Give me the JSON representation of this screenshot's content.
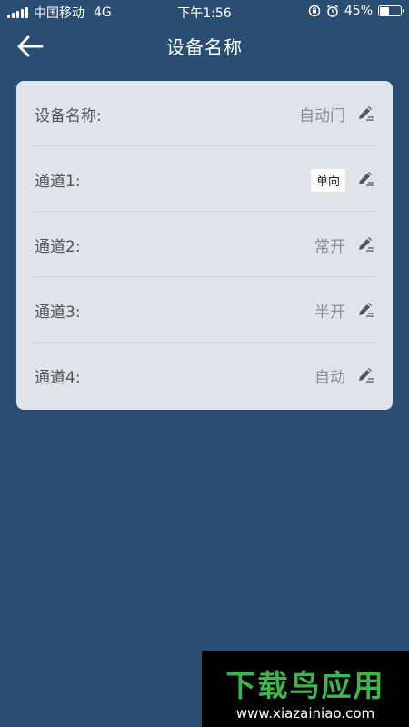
{
  "status_bar": {
    "carrier": "中国移动",
    "network": "4G",
    "time": "下午1:56",
    "battery_percent": "45%",
    "battery_level": 0.45,
    "icons": [
      "signal-icon",
      "lock-rotation-icon",
      "alarm-icon",
      "battery-icon"
    ]
  },
  "header": {
    "title": "设备名称",
    "back_icon": "arrow-left-icon"
  },
  "rows": [
    {
      "label": "设备名称:",
      "value": "自动门"
    },
    {
      "label": "通道1:",
      "value": "单向"
    },
    {
      "label": "通道2:",
      "value": "常开"
    },
    {
      "label": "通道3:",
      "value": "半开"
    },
    {
      "label": "通道4:",
      "value": "自动"
    }
  ],
  "watermark": {
    "brand": "下载鸟应用",
    "url": "www.xiazainiao.com"
  },
  "colors": {
    "background": "#2a4d72",
    "card": "#dfe3ea",
    "label_text": "#555555",
    "value_text": "#8b8f96",
    "watermark_green": "#3fb64a"
  }
}
